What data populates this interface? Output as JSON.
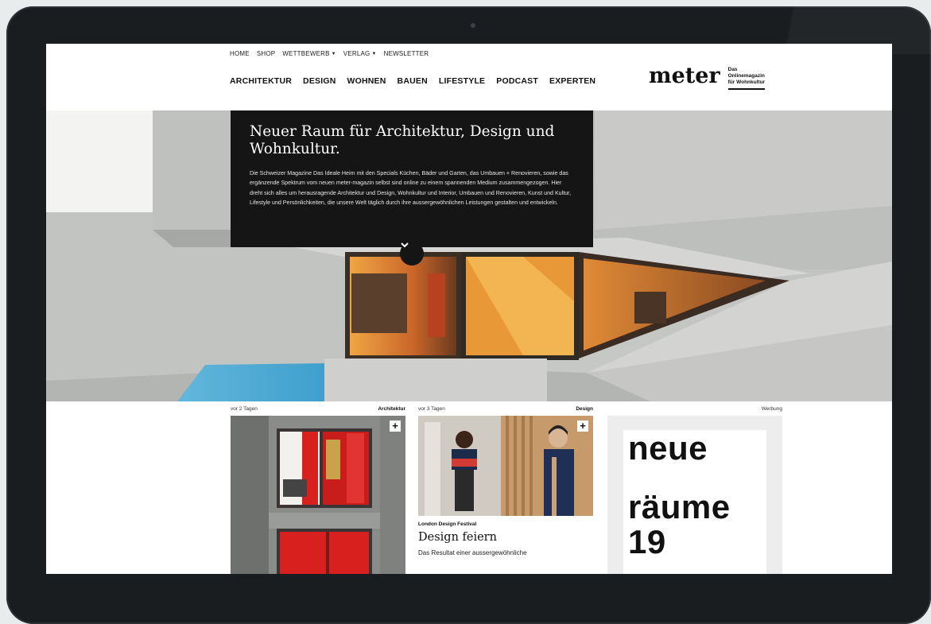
{
  "topnav": {
    "home": "HOME",
    "shop": "SHOP",
    "wettbewerb": "WETTBEWERB",
    "verlag": "VERLAG",
    "newsletter": "NEWSLETTER"
  },
  "mainnav": {
    "items": [
      "ARCHITEKTUR",
      "DESIGN",
      "WOHNEN",
      "BAUEN",
      "LIFESTYLE",
      "PODCAST",
      "EXPERTEN"
    ]
  },
  "logo": {
    "name": "meter",
    "tagline": [
      "Das",
      "Onlinemagazin",
      "für Wohnkultur"
    ]
  },
  "hero": {
    "title": "Neuer Raum für Architektur, Design und Wohnkultur.",
    "text": "Die Schweizer Magazine Das Ideale Heim mit den Specials Küchen, Bäder und Garten, das Umbauen + Renovieren, sowie das ergänzende Spektrum vom neuen meter-magazin selbst sind online zu einem spannenden Medium zusammengezogen. Hier dreht sich alles um herausragende Architektur und Design, Wohnkultur und Interior, Umbauen und Renovieren, Kunst und Kultur, Lifestyle und Persönlichkeiten, die unsere Welt täglich durch ihre aussergewöhnlichen Leistungen gestalten und entwickeln."
  },
  "cards": [
    {
      "time": "vor 2 Tagen",
      "category": "Architektur"
    },
    {
      "time": "vor 3 Tagen",
      "category": "Design",
      "kicker": "London Design Festival",
      "title": "Design feiern",
      "excerpt": "Das Resultat einer aussergewöhnliche"
    }
  ],
  "ad": {
    "label": "Werbung",
    "lines": [
      "neue",
      "räume",
      "19"
    ]
  },
  "colors": {
    "header_bg": "#ffffff",
    "hero_box_bg": "#151515",
    "device_frame": "#1a1d20",
    "accent_red": "#d8201f",
    "window_orange": "#e8852a"
  }
}
